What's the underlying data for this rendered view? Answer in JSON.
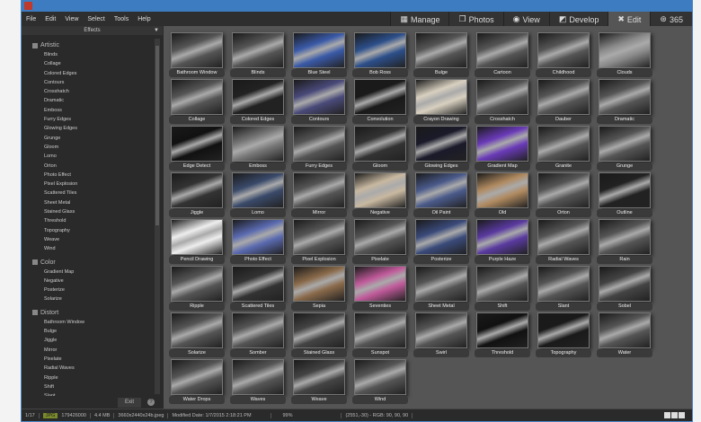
{
  "menu": [
    "File",
    "Edit",
    "View",
    "Select",
    "Tools",
    "Help"
  ],
  "modes": [
    {
      "label": "Manage",
      "icon": "▦"
    },
    {
      "label": "Photos",
      "icon": "❐"
    },
    {
      "label": "View",
      "icon": "◉"
    },
    {
      "label": "Develop",
      "icon": "◩"
    },
    {
      "label": "Edit",
      "icon": "✖",
      "active": true
    },
    {
      "label": "365",
      "icon": "⊛"
    }
  ],
  "sidebar": {
    "header": "Effects",
    "exit": "Exit",
    "help": "?",
    "groups": [
      {
        "name": "Artistic",
        "items": [
          "Blinds",
          "Collage",
          "Colored Edges",
          "Contours",
          "Crosshatch",
          "Dramatic",
          "Emboss",
          "Furry Edges",
          "Glowing Edges",
          "Grunge",
          "Gloom",
          "Lomo",
          "Orton",
          "Photo Effect",
          "Pixel Explosion",
          "Scattered Tiles",
          "Sheet Metal",
          "Stained Glass",
          "Threshold",
          "Topography",
          "Weave",
          "Wind"
        ]
      },
      {
        "name": "Color",
        "items": [
          "Gradient Map",
          "Negative",
          "Posterize",
          "Solarize"
        ]
      },
      {
        "name": "Distort",
        "items": [
          "Bathroom Window",
          "Bulge",
          "Jiggle",
          "Mirror",
          "Pixelate",
          "Radial Waves",
          "Ripple",
          "Shift",
          "Slant"
        ]
      }
    ]
  },
  "effects": [
    {
      "n": "Bathroom Window"
    },
    {
      "n": "Blinds"
    },
    {
      "n": "Blue Steel",
      "c": "#3a5aa8"
    },
    {
      "n": "Bob Ross",
      "c": "#2c4f8a"
    },
    {
      "n": "Bulge"
    },
    {
      "n": "Cartoon"
    },
    {
      "n": "Childhood"
    },
    {
      "n": "Clouds",
      "c": "#8a8a8a"
    },
    {
      "n": "Collage"
    },
    {
      "n": "Colored Edges",
      "c": "#222"
    },
    {
      "n": "Contours",
      "c": "#4a4a7a"
    },
    {
      "n": "Convolution",
      "c": "#1a1a1a"
    },
    {
      "n": "Crayon Drawing",
      "c": "#d8d0c0"
    },
    {
      "n": "Crosshatch"
    },
    {
      "n": "Dauber"
    },
    {
      "n": "Dramatic"
    },
    {
      "n": "Edge Detect",
      "c": "#111"
    },
    {
      "n": "Emboss",
      "c": "#777"
    },
    {
      "n": "Furry Edges"
    },
    {
      "n": "Gloom",
      "c": "#333"
    },
    {
      "n": "Glowing Edges",
      "c": "#1a1a2a"
    },
    {
      "n": "Gradient Map",
      "c": "#6a3ab8"
    },
    {
      "n": "Granite"
    },
    {
      "n": "Grunge"
    },
    {
      "n": "Jiggle",
      "c": "#333"
    },
    {
      "n": "Lomo",
      "c": "#3a4a6a"
    },
    {
      "n": "Mirror"
    },
    {
      "n": "Negative",
      "c": "#c8b8a0"
    },
    {
      "n": "Oil Paint",
      "c": "#4a5a8a"
    },
    {
      "n": "Old",
      "c": "#b08a60"
    },
    {
      "n": "Orton"
    },
    {
      "n": "Outline",
      "c": "#222"
    },
    {
      "n": "Pencil Drawing",
      "c": "#eee"
    },
    {
      "n": "Photo Effect",
      "c": "#5a6ab0"
    },
    {
      "n": "Pixel Explosion"
    },
    {
      "n": "Pixelate"
    },
    {
      "n": "Posterize",
      "c": "#3a4a7a"
    },
    {
      "n": "Purple Haze",
      "c": "#5a3aa0"
    },
    {
      "n": "Radial Waves"
    },
    {
      "n": "Rain"
    },
    {
      "n": "Ripple"
    },
    {
      "n": "Scattered Tiles",
      "c": "#333"
    },
    {
      "n": "Sepia",
      "c": "#8a6a4a"
    },
    {
      "n": "Seventies",
      "c": "#c05a9a"
    },
    {
      "n": "Sheet Metal"
    },
    {
      "n": "Shift"
    },
    {
      "n": "Slant"
    },
    {
      "n": "Sobel",
      "c": "#444"
    },
    {
      "n": "Solarize"
    },
    {
      "n": "Somber"
    },
    {
      "n": "Stained Glass",
      "c": "#444"
    },
    {
      "n": "Sunspot"
    },
    {
      "n": "Swirl"
    },
    {
      "n": "Threshold",
      "c": "#111"
    },
    {
      "n": "Topography",
      "c": "#1a1a1a"
    },
    {
      "n": "Water"
    },
    {
      "n": "Water Drops"
    },
    {
      "n": "Waves"
    },
    {
      "n": "Weave",
      "c": "#444"
    },
    {
      "n": "Wind"
    }
  ],
  "status": {
    "index": "1/17",
    "type": "JPG",
    "bytes": "179426000",
    "size": "4.4 MB",
    "dims": "3660x2440x24b.jpeg",
    "modified": "Modified Date: 1/7/2015 2:18:21 PM",
    "zoom": "99%",
    "pixel": "(2551,-30) - RGB: 90, 90, 90"
  }
}
